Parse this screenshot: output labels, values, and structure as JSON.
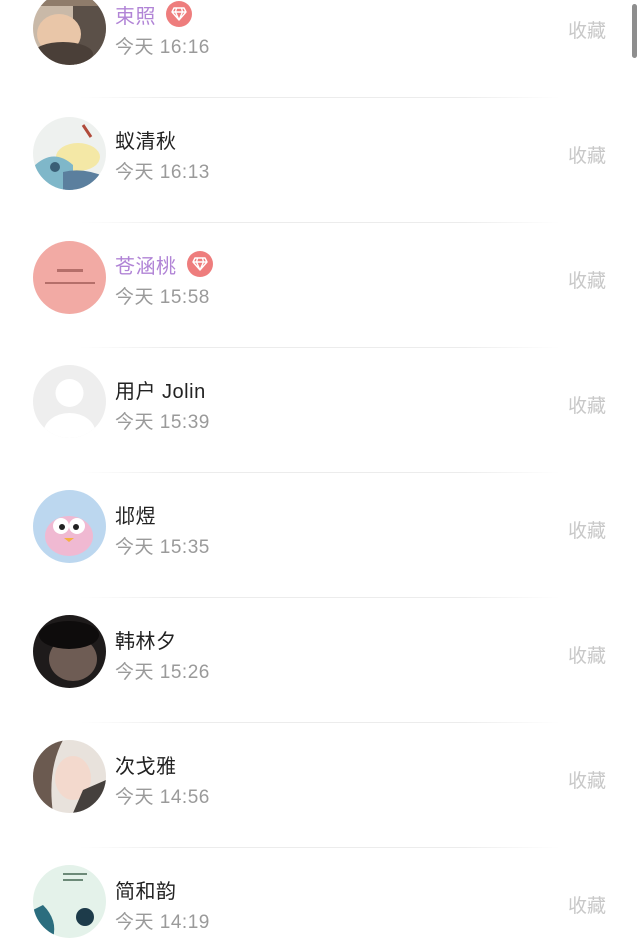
{
  "favorite_label": "收藏",
  "users": [
    {
      "name": "束照",
      "time": "今天 16:16",
      "vip": true
    },
    {
      "name": "蚁清秋",
      "time": "今天 16:13",
      "vip": false
    },
    {
      "name": "苍涵桃",
      "time": "今天 15:58",
      "vip": true
    },
    {
      "name": "用户 Jolin",
      "time": "今天 15:39",
      "vip": false
    },
    {
      "name": "邶煜",
      "time": "今天 15:35",
      "vip": false
    },
    {
      "name": "韩林夕",
      "time": "今天 15:26",
      "vip": false
    },
    {
      "name": "次戈雅",
      "time": "今天 14:56",
      "vip": false
    },
    {
      "name": "简和韵",
      "time": "今天 14:19",
      "vip": false
    }
  ],
  "colors": {
    "vip_name": "#b184d6",
    "vip_badge": "#ee7d7d",
    "name": "#222222",
    "time": "#9a9a9a",
    "favorite": "#c8c8c8"
  }
}
